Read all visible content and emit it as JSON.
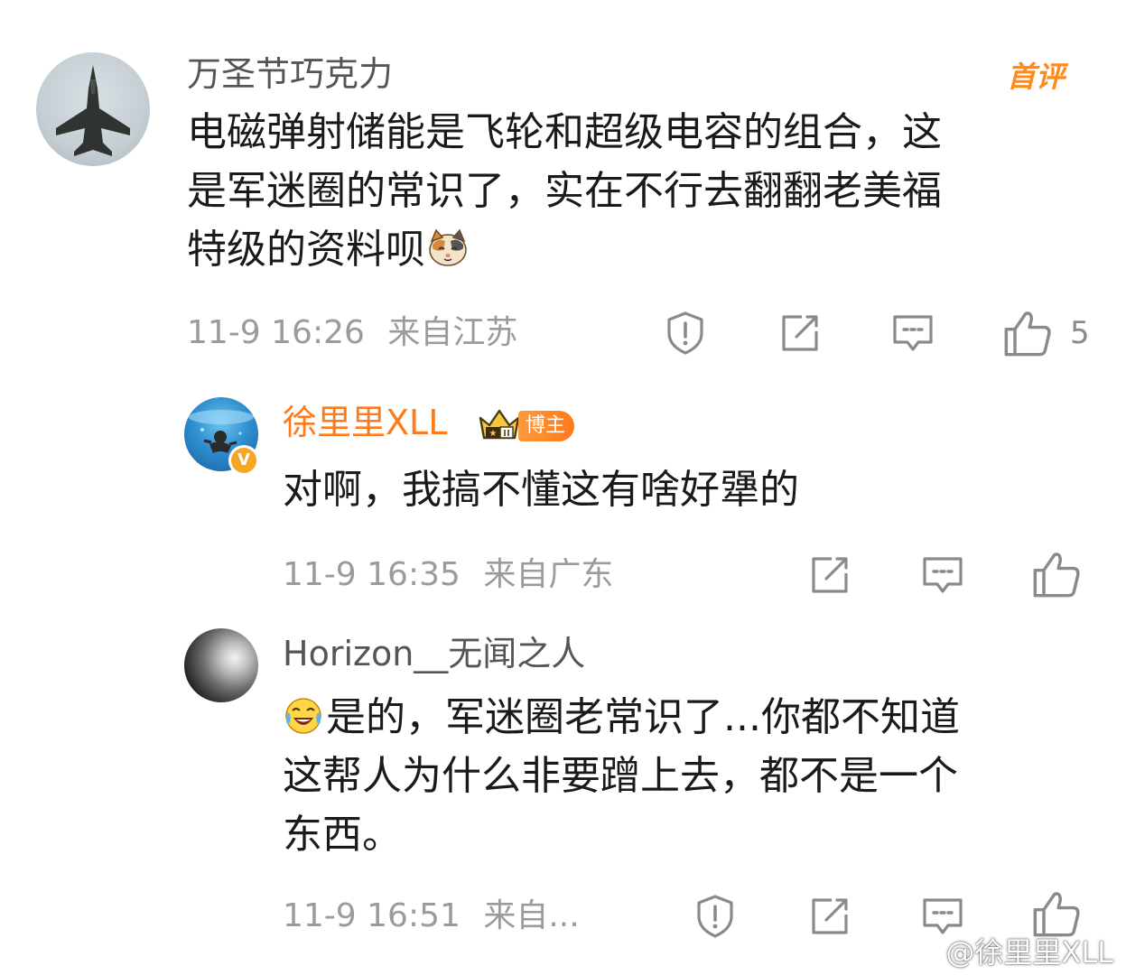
{
  "colors": {
    "username_default": "#555555",
    "username_vip": "#ff7a1a",
    "meta": "#9b9b9b",
    "first_badge": "#ff8a1c"
  },
  "comments": [
    {
      "username": "万圣节巧克力",
      "avatar_icon": "fighter-jet-avatar",
      "badge": "首评",
      "text_lines": [
        "电磁弹射储能是飞轮和超级电容的组合，这",
        "是军迷圈的常识了，实在不行去翻翻老美福",
        "特级的资料呗"
      ],
      "emoji": "cat-emoji",
      "time": "11-9 16:26",
      "location": "来自江苏",
      "like_count": "5"
    },
    {
      "username": "徐里里XLL",
      "avatar_icon": "underwater-avatar",
      "blogger_tag": "博主",
      "verified_badge": "V",
      "text_lines": [
        "对啊，我搞不懂这有啥好犟的"
      ],
      "time": "11-9 16:35",
      "location": "来自广东"
    },
    {
      "username": "Horizon__无闻之人",
      "avatar_icon": "gray-sphere-avatar",
      "emoji": "laugh-cry-emoji",
      "text_lines": [
        "是的，军迷圈老常识了...你都不知道",
        "这帮人为什么非要蹭上去，都不是一个",
        "东西。"
      ],
      "time": "11-9 16:51",
      "location": "来自..."
    }
  ],
  "watermark": "@徐里里XLL"
}
